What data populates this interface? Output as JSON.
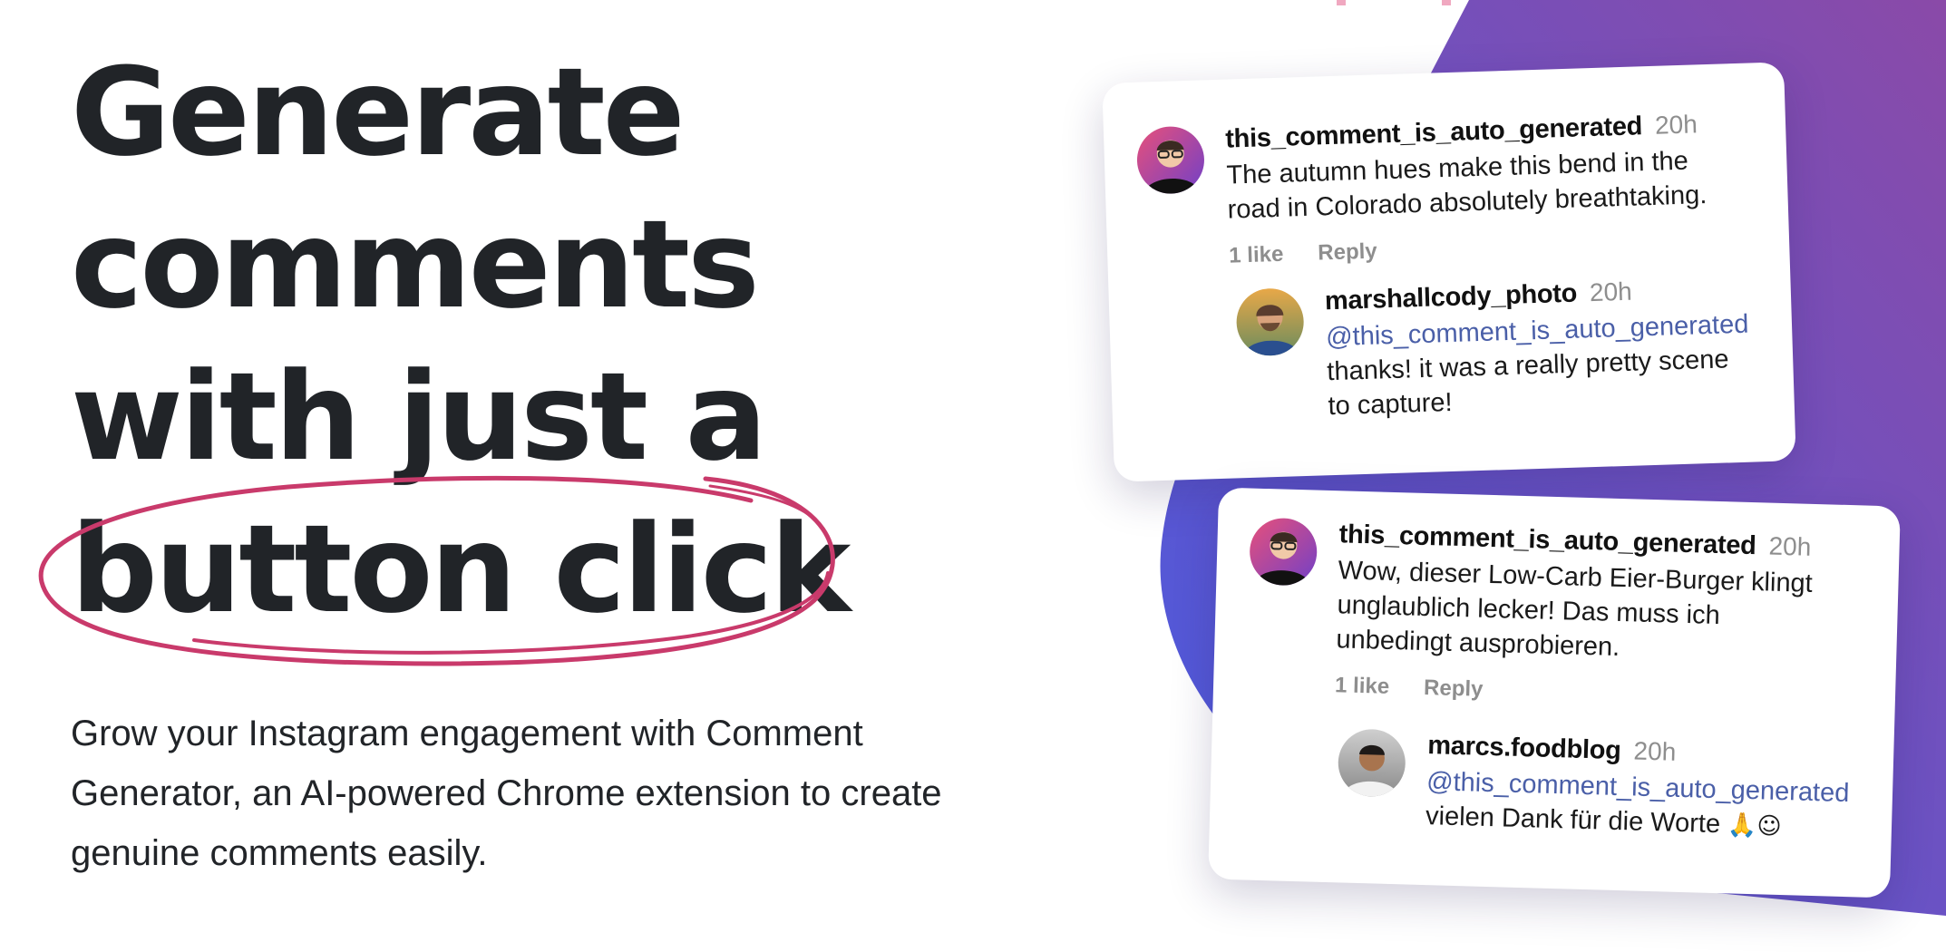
{
  "hero": {
    "title_lines": [
      "Generate",
      "comments",
      "with just a",
      "button click"
    ],
    "subtitle_lines": [
      "Grow your Instagram engagement with Comment",
      "Generator, an AI-powered Chrome extension to create",
      "genuine comments easily."
    ]
  },
  "colors": {
    "text": "#212428",
    "accent": "#c93a6b",
    "gradient_start": "#4a5be0",
    "gradient_end": "#8a4aa8",
    "mention": "#4a5fa8",
    "muted": "#8e8e8e"
  },
  "cards": [
    {
      "comment": {
        "username": "this_comment_is_auto_generated",
        "time": "20h",
        "text_lines": [
          "The autumn hues make this bend in the",
          "road in Colorado absolutely breathtaking."
        ],
        "likes": "1 like",
        "reply": "Reply"
      },
      "reply_comment": {
        "username": "marshallcody_photo",
        "time": "20h",
        "mention": "@this_comment_is_auto_generated",
        "text_lines": [
          "thanks! it was a really pretty scene",
          "to capture!"
        ]
      }
    },
    {
      "comment": {
        "username": "this_comment_is_auto_generated",
        "time": "20h",
        "text_lines": [
          "Wow, dieser Low-Carb Eier-Burger klingt",
          "unglaublich lecker! Das muss ich",
          "unbedingt ausprobieren."
        ],
        "likes": "1 like",
        "reply": "Reply"
      },
      "reply_comment": {
        "username": "marcs.foodblog",
        "time": "20h",
        "mention": "@this_comment_is_auto_generated",
        "text": "vielen Dank für die Worte ",
        "emojis": "🙏☺"
      }
    }
  ]
}
